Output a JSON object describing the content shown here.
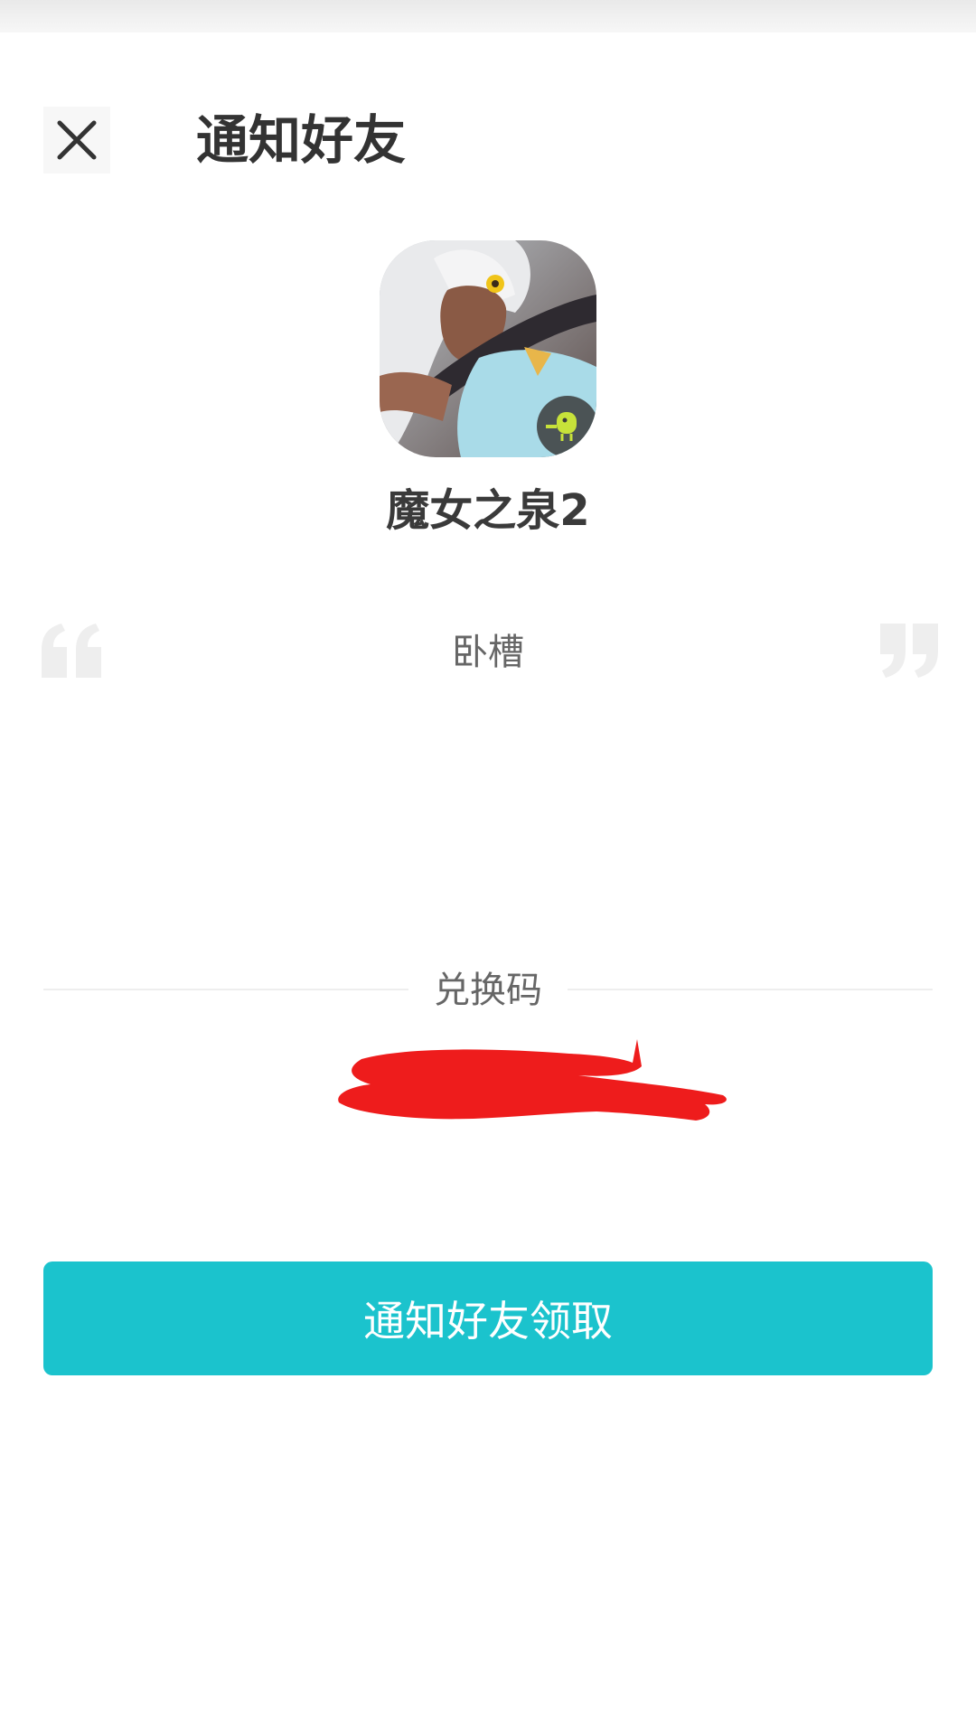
{
  "header": {
    "close_icon": "close-icon",
    "title": "通知好友"
  },
  "app": {
    "name": "魔女之泉2",
    "icon": "game-app-icon",
    "badge_icon": "green-bird-badge-icon"
  },
  "message": {
    "open_quote_icon": "open-quote-icon",
    "text": "卧槽",
    "close_quote_icon": "close-quote-icon"
  },
  "code": {
    "label": "兑换码"
  },
  "actions": {
    "notify_label": "通知好友领取"
  },
  "colors": {
    "accent": "#1bc3cd",
    "redaction": "#ee1c1c",
    "title": "#333333",
    "muted_text": "#666666"
  }
}
